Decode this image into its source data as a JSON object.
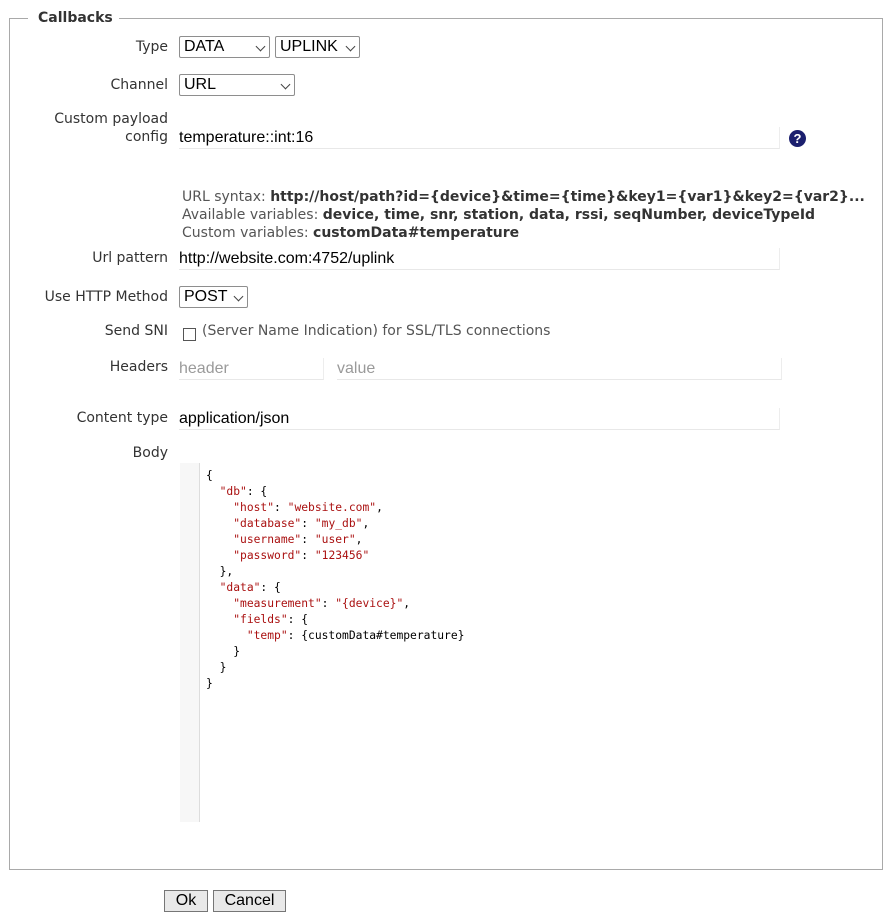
{
  "legend": "Callbacks",
  "type": {
    "label": "Type",
    "type_value": "DATA",
    "direction_value": "UPLINK"
  },
  "channel": {
    "label": "Channel",
    "value": "URL"
  },
  "custom_payload": {
    "label_line1": "Custom payload",
    "label_line2": "config",
    "value": "temperature::int:16",
    "help_icon": "question-circle-icon"
  },
  "url_info": {
    "syntax_label": "URL syntax:",
    "syntax_value": "http://host/path?id={device}&time={time}&key1={var1}&key2={var2}...",
    "available_label": "Available variables:",
    "available_value": "device, time, snr, station, data, rssi, seqNumber, deviceTypeId",
    "custom_label": "Custom variables:",
    "custom_value": "customData#temperature"
  },
  "url_pattern": {
    "label": "Url pattern",
    "value": "http://website.com:4752/uplink"
  },
  "http_method": {
    "label": "Use HTTP Method",
    "value": "POST"
  },
  "send_sni": {
    "label": "Send SNI",
    "text": "(Server Name Indication) for SSL/TLS connections",
    "checked": false
  },
  "headers": {
    "label": "Headers",
    "header_placeholder": "header",
    "value_placeholder": "value"
  },
  "content_type": {
    "label": "Content type",
    "value": "application/json"
  },
  "body": {
    "label": "Body",
    "text": "{\n  \"db\": {\n    \"host\": \"website.com\",\n    \"database\": \"my_db\",\n    \"username\": \"user\",\n    \"password\": \"123456\"\n  },\n  \"data\": {\n    \"measurement\": \"{device}\",\n    \"fields\": {\n      \"temp\": {customData#temperature}\n    }\n  }\n}"
  },
  "buttons": {
    "ok": "Ok",
    "cancel": "Cancel"
  },
  "colors": {
    "help_icon": "#1b1f6e",
    "json_key": "#aa1111",
    "json_string": "#aa1111"
  }
}
